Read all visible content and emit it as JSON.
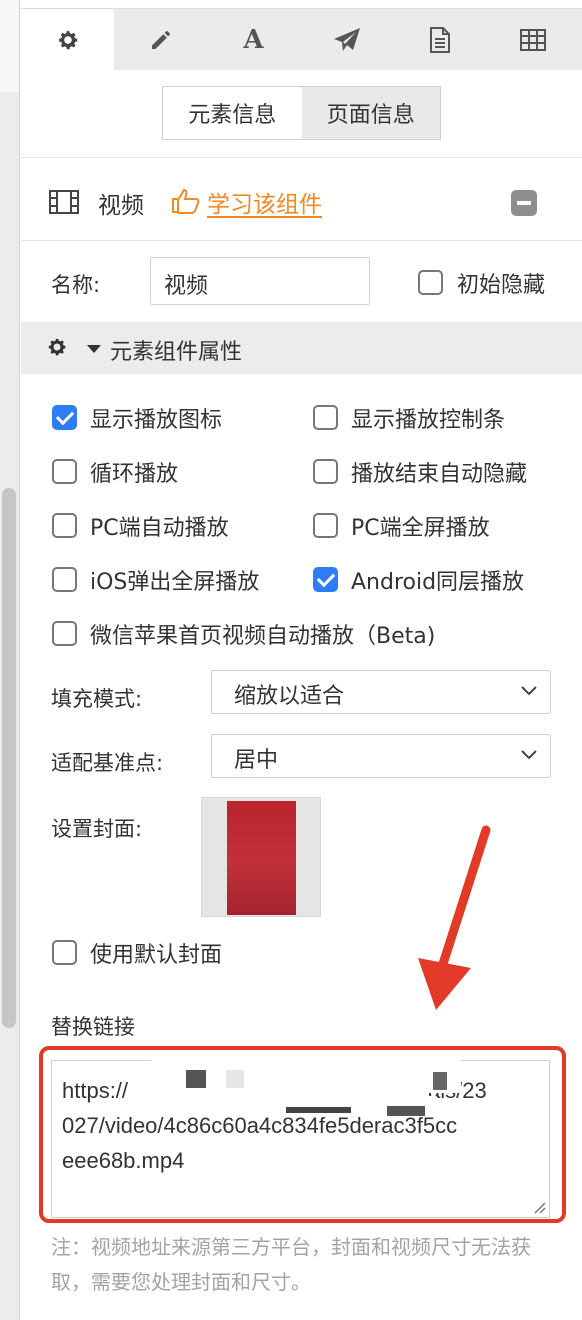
{
  "tabs": [
    {
      "name": "settings",
      "icon": "gear-icon",
      "active": true
    },
    {
      "name": "edit",
      "icon": "pencil-icon",
      "active": false
    },
    {
      "name": "text",
      "icon": "letter-a-icon",
      "label": "A",
      "active": false
    },
    {
      "name": "send",
      "icon": "paper-plane-icon",
      "active": false
    },
    {
      "name": "document",
      "icon": "document-icon",
      "active": false
    },
    {
      "name": "table",
      "icon": "table-icon",
      "active": false
    }
  ],
  "segmented": {
    "element_info": "元素信息",
    "page_info": "页面信息"
  },
  "component": {
    "name": "视频",
    "learn_link": "学习该组件"
  },
  "name_row": {
    "label": "名称:",
    "value": "视频",
    "hidden_label": "初始隐藏"
  },
  "section": {
    "title": "元素组件属性"
  },
  "options": [
    {
      "label": "显示播放图标",
      "checked": true
    },
    {
      "label": "显示播放控制条",
      "checked": false
    },
    {
      "label": "循环播放",
      "checked": false
    },
    {
      "label": "播放结束自动隐藏",
      "checked": false
    },
    {
      "label": "PC端自动播放",
      "checked": false
    },
    {
      "label": "PC端全屏播放",
      "checked": false
    },
    {
      "label": "iOS弹出全屏播放",
      "checked": false
    },
    {
      "label": "Android同层播放",
      "checked": true
    },
    {
      "label": "微信苹果首页视频自动播放（Beta)",
      "checked": false
    }
  ],
  "fill_mode": {
    "label": "填充模式:",
    "value": "缩放以适合"
  },
  "anchor": {
    "label": "适配基准点:",
    "value": "居中"
  },
  "cover": {
    "label": "设置封面:",
    "default_label": "使用默认封面"
  },
  "replace_link": {
    "label": "替换链接",
    "value_visible": "https://                    als/23 027/video/4c86c60a4c834fe5derac3f5cc eee68b.mp4",
    "line1_start": "https://",
    "line1_end": "als/23",
    "line2": "027/video/4c86c60a4c834fe5derac3f5cc",
    "line3": "eee68b.mp4"
  },
  "note": "注：视频地址来源第三方平台，封面和视频尺寸无法获取，需要您处理封面和尺寸。",
  "colors": {
    "accent_blue": "#2f7df6",
    "link_orange": "#f28a23",
    "annotation_red": "#e33a27"
  }
}
